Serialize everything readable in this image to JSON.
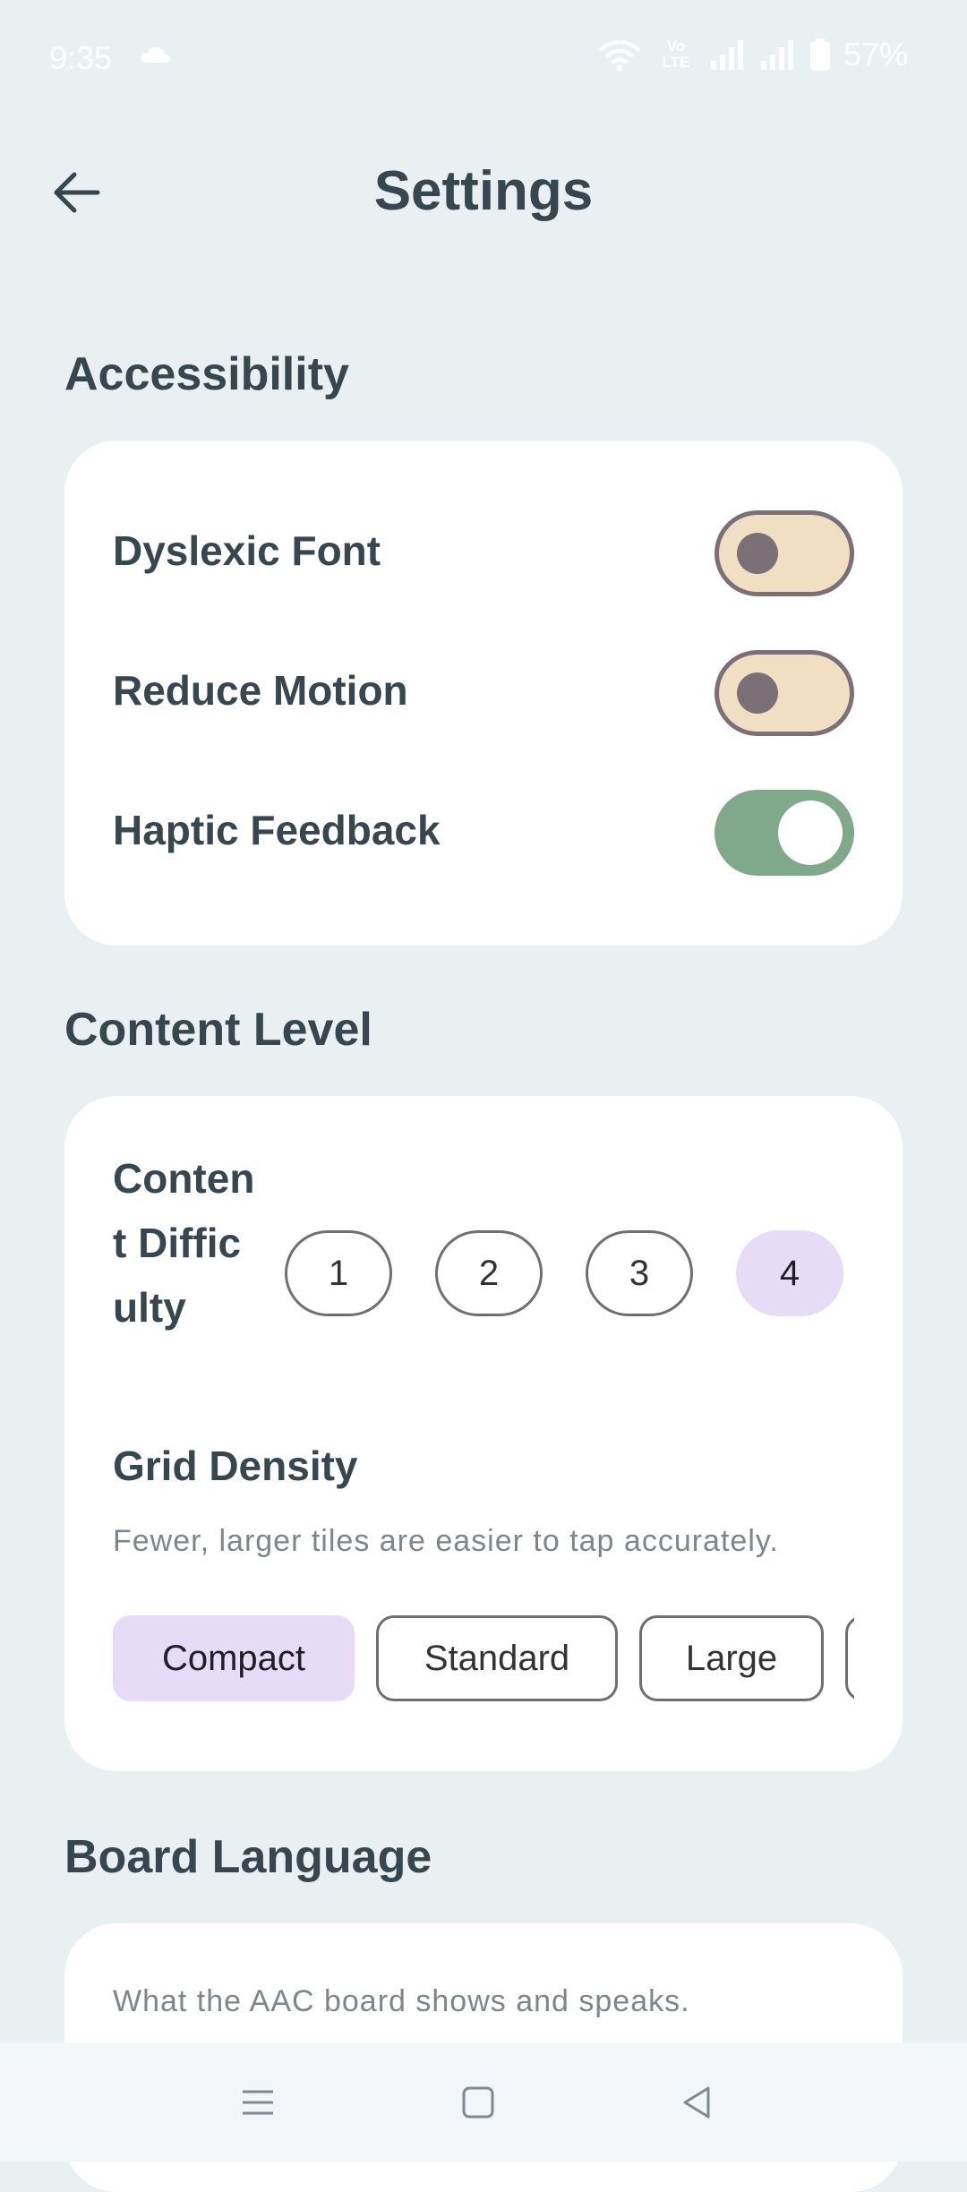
{
  "status_bar": {
    "time": "9:35",
    "battery": "57%",
    "network_badge": "Vo LTE"
  },
  "header": {
    "title": "Settings",
    "back_icon": "arrow-left-icon"
  },
  "accessibility": {
    "title": "Accessibility",
    "items": [
      {
        "label": "Dyslexic Font",
        "enabled": false
      },
      {
        "label": "Reduce Motion",
        "enabled": false
      },
      {
        "label": "Haptic Feedback",
        "enabled": true
      }
    ]
  },
  "content_level": {
    "title": "Content Level",
    "difficulty_label": "Content Difficulty",
    "difficulty_options": [
      "1",
      "2",
      "3",
      "4"
    ],
    "difficulty_selected": "4",
    "grid_density_title": "Grid Density",
    "grid_density_hint": "Fewer, larger tiles are easier to tap accurately.",
    "grid_density_options": [
      "Compact",
      "Standard",
      "Large"
    ],
    "grid_density_selected": "Compact"
  },
  "board_language": {
    "title": "Board Language",
    "hint": "What the AAC board shows and speaks."
  },
  "colors": {
    "background": "#e8f0f2",
    "toggle_on": "#7fa98a",
    "toggle_off": "#f1dfc4",
    "selected_chip": "#e6dcf5"
  },
  "nav_bar": {
    "menu_icon": "menu-icon",
    "home_icon": "home-square-icon",
    "back_icon": "back-triangle-icon"
  }
}
